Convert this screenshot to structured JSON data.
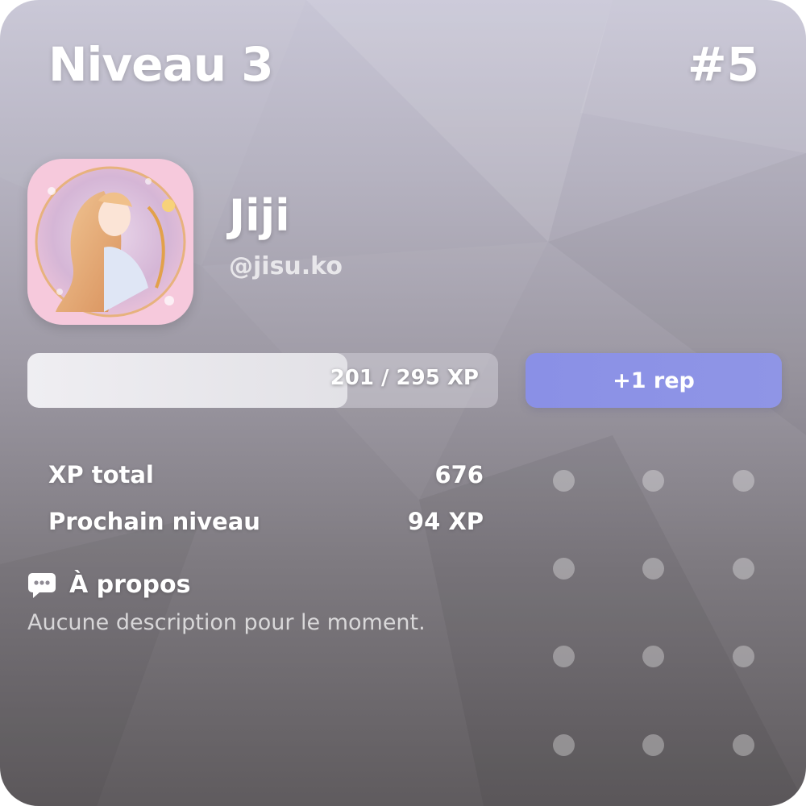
{
  "card": {
    "level_title": "Niveau 3",
    "rank": "#5",
    "user": {
      "display_name": "Jiji",
      "handle": "@jisu.ko"
    },
    "xp": {
      "current": 201,
      "target": 295,
      "text": "201 / 295 XP",
      "progress_fraction": 0.68
    },
    "rep_button_label": "+1 rep",
    "stats": [
      {
        "label": "XP total",
        "value": "676"
      },
      {
        "label": "Prochain niveau",
        "value": "94 XP"
      }
    ],
    "about": {
      "icon": "chat-bubble-icon",
      "title": "À propos",
      "description": "Aucune description pour le moment."
    }
  },
  "colors": {
    "rep_button": "#8a90e6",
    "xp_fill": "#e9e8ed",
    "text": "#ffffff",
    "avatar_pink": "#f6c9dc"
  }
}
